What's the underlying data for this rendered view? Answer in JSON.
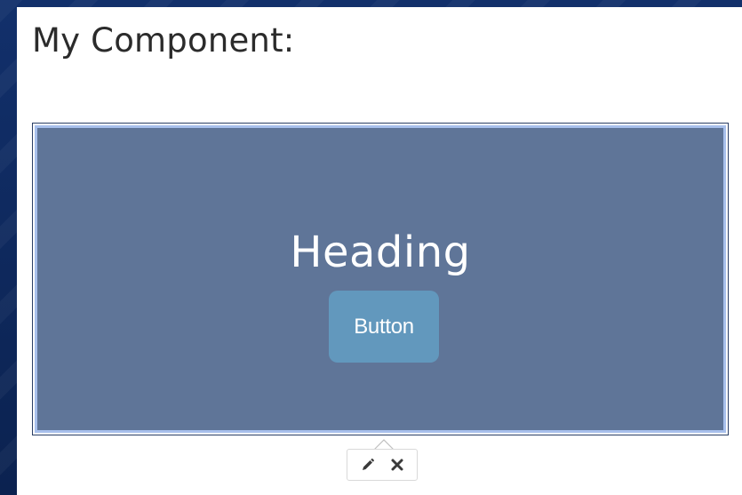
{
  "page": {
    "title": "My Component:"
  },
  "component": {
    "heading": "Heading",
    "button_label": "Button",
    "colors": {
      "background": "#5f7598",
      "selection_outline": "#a8c0ec",
      "button": "#6298bd"
    }
  },
  "toolbar": {
    "edit_icon": "pencil-icon",
    "delete_icon": "close-icon"
  }
}
